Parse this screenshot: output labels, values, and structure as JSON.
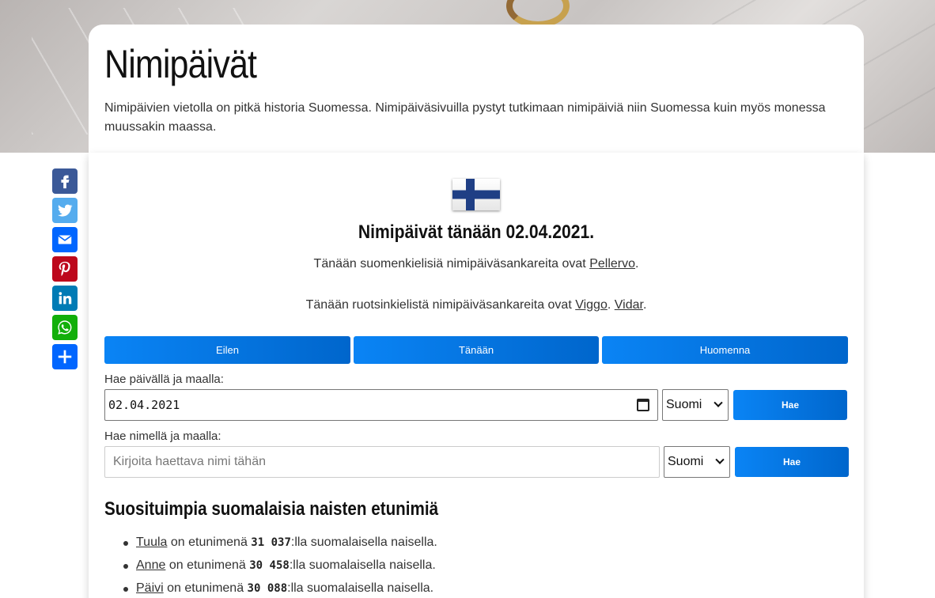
{
  "header": {
    "title": "Nimipäivät",
    "intro": "Nimipäivien vietolla on pitkä historia Suomessa. Nimipäiväsivuilla pystyt tutkimaan nimipäiviä niin Suomessa kuin myös monessa muussakin maassa."
  },
  "share": [
    "facebook-icon",
    "twitter-icon",
    "email-icon",
    "pinterest-icon",
    "linkedin-icon",
    "whatsapp-icon",
    "share-icon"
  ],
  "today": {
    "title": "Nimipäivät tänään 02.04.2021.",
    "fi_prefix": "Tänään suomenkielisiä nimipäiväsankareita ovat ",
    "fi_names": [
      "Pellervo"
    ],
    "sv_prefix": "Tänään ruotsinkielistä nimipäiväsankareita ovat ",
    "sv_names": [
      "Viggo",
      "Vidar"
    ]
  },
  "nav": {
    "yesterday": "Eilen",
    "today": "Tänään",
    "tomorrow": "Huomenna"
  },
  "search_date": {
    "label": "Hae päivällä ja maalla:",
    "value": "02.04.2021",
    "country": "Suomi",
    "button": "Hae"
  },
  "search_name": {
    "label": "Hae nimellä ja maalla:",
    "placeholder": "Kirjoita haettava nimi tähän",
    "country": "Suomi",
    "button": "Hae"
  },
  "popular": {
    "title": "Suosituimpia suomalaisia naisten etunimiä",
    "items": [
      {
        "name": "Tuula",
        "middle": " on etunimenä ",
        "count": "31 037",
        "suffix": ":lla suomalaisella naisella."
      },
      {
        "name": "Anne",
        "middle": " on etunimenä ",
        "count": "30 458",
        "suffix": ":lla suomalaisella naisella."
      },
      {
        "name": "Päivi",
        "middle": " on etunimenä ",
        "count": "30 088",
        "suffix": ":lla suomalaisella naisella."
      }
    ]
  },
  "colors": {
    "button_blue": "#0a84f5",
    "facebook": "#3b5998",
    "twitter": "#55acee",
    "email": "#0166ff",
    "pinterest": "#bd081c",
    "linkedin": "#007bb5",
    "whatsapp": "#12af0a",
    "share": "#0166ff"
  }
}
